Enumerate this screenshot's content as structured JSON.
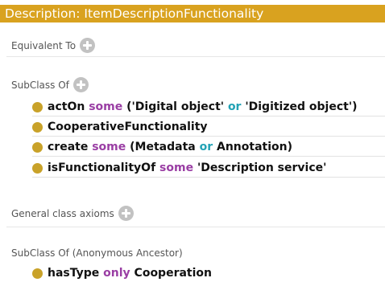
{
  "header": {
    "title": "Description: ItemDescriptionFunctionality"
  },
  "sections": {
    "equivalent_to": {
      "title": "Equivalent To"
    },
    "subclass_of": {
      "title": "SubClass Of",
      "axioms": [
        {
          "tokens": [
            {
              "text": "actOn ",
              "style": "plain"
            },
            {
              "text": "some",
              "style": "purple"
            },
            {
              "text": " ('Digital object' ",
              "style": "plain"
            },
            {
              "text": "or",
              "style": "teal"
            },
            {
              "text": " 'Digitized object')",
              "style": "plain"
            }
          ]
        },
        {
          "tokens": [
            {
              "text": "CooperativeFunctionality",
              "style": "plain"
            }
          ]
        },
        {
          "tokens": [
            {
              "text": "create ",
              "style": "plain"
            },
            {
              "text": "some",
              "style": "purple"
            },
            {
              "text": " (Metadata ",
              "style": "plain"
            },
            {
              "text": "or",
              "style": "teal"
            },
            {
              "text": " Annotation)",
              "style": "plain"
            }
          ]
        },
        {
          "tokens": [
            {
              "text": "isFunctionalityOf ",
              "style": "plain"
            },
            {
              "text": "some",
              "style": "purple"
            },
            {
              "text": " 'Description service'",
              "style": "plain"
            }
          ]
        }
      ]
    },
    "general_class_axioms": {
      "title": "General class axioms"
    },
    "subclass_of_anonymous": {
      "title": "SubClass Of (Anonymous Ancestor)",
      "axioms": [
        {
          "tokens": [
            {
              "text": "hasType ",
              "style": "plain"
            },
            {
              "text": "only",
              "style": "purple"
            },
            {
              "text": " Cooperation",
              "style": "plain"
            }
          ]
        }
      ]
    }
  },
  "colors": {
    "header_bg": "#d9a21f",
    "class_dot": "#c9a229",
    "keyword_purple": "#9a3ea4",
    "keyword_teal": "#22a2b5"
  },
  "icons": {
    "add": "plus-circle-icon",
    "class": "class-dot-icon"
  }
}
